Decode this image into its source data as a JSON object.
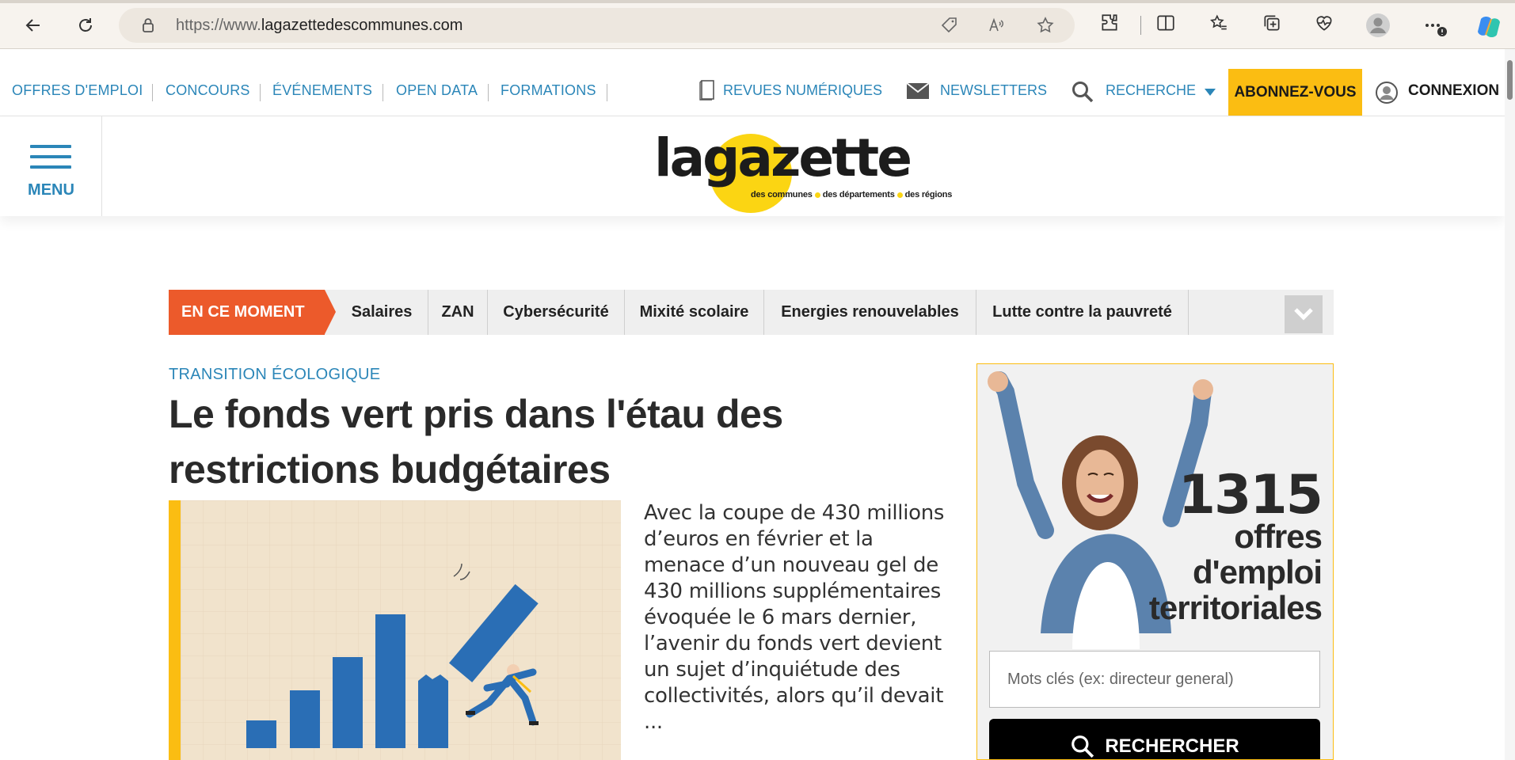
{
  "browser": {
    "url_prefix": "https://www.",
    "url_domain": "lagazettedescommunes.com"
  },
  "topnav": {
    "links": [
      "OFFRES D'EMPLOI",
      "CONCOURS",
      "ÉVÉNEMENTS",
      "OPEN DATA",
      "FORMATIONS"
    ],
    "revues": "REVUES NUMÉRIQUES",
    "newsletters": "NEWSLETTERS",
    "recherche": "RECHERCHE",
    "subscribe": "ABONNEZ-VOUS",
    "connexion": "CONNEXION"
  },
  "header": {
    "menu_label": "MENU",
    "logo_word": "lagazette",
    "logo_sub": [
      "des communes",
      "des départements",
      "des régions"
    ]
  },
  "trending": {
    "label": "EN CE MOMENT",
    "tags": [
      "Salaires",
      "ZAN",
      "Cybersécurité",
      "Mixité scolaire",
      "Energies renouvelables",
      "Lutte contre la pauvreté"
    ]
  },
  "article": {
    "category": "TRANSITION ÉCOLOGIQUE",
    "headline": "Le fonds vert pris dans l'étau des restrictions budgétaires",
    "excerpt": "Avec la coupe de 430 millions d’euros en février et la menace d’un nouveau gel de 430 millions supplémentaires évoquée le 6 mars dernier, l’avenir du fonds vert devient un sujet d’inquiétude des collectivités, alors qu’il devait ..."
  },
  "jobs": {
    "count": "1315",
    "text": "offres d'emploi territoriales",
    "search_placeholder": "Mots clés (ex: directeur general)",
    "search_button": "RECHERCHER"
  },
  "colors": {
    "link_blue": "#2b86b8",
    "subscribe_yellow": "#fbbd12",
    "trend_orange": "#ec5a2b",
    "logo_yellow": "#fbd513"
  }
}
